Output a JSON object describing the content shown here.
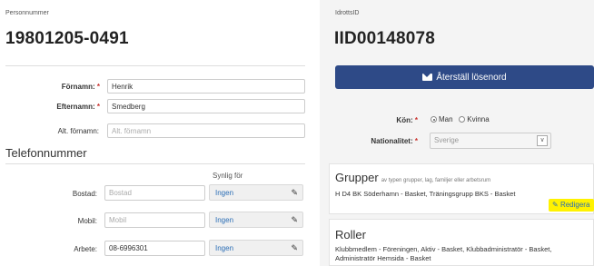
{
  "left": {
    "person_label": "Personnummer",
    "person_number": "19801205-0491",
    "fields": {
      "fornamn_label": "Förnamn:",
      "fornamn_value": "Henrik",
      "efternamn_label": "Efternamn:",
      "efternamn_value": "Smedberg",
      "alt_fornamn_label": "Alt. förnamn:",
      "alt_fornamn_placeholder": "Alt. förnamn",
      "required_mark": "*"
    },
    "phone": {
      "section_title": "Telefonnummer",
      "visible_for_header": "Synlig för",
      "rows": [
        {
          "label": "Bostad:",
          "value": "",
          "placeholder": "Bostad",
          "visibility": "Ingen"
        },
        {
          "label": "Mobil:",
          "value": "",
          "placeholder": "Mobil",
          "visibility": "Ingen"
        },
        {
          "label": "Arbete:",
          "value": "08-6996301",
          "placeholder": "",
          "visibility": "Ingen"
        }
      ]
    }
  },
  "right": {
    "idrotts_label": "IdrottsID",
    "idrotts_id": "IID00148078",
    "reset_button": "Återställ lösenord",
    "gender": {
      "label": "Kön:",
      "options": [
        "Man",
        "Kvinna"
      ],
      "selected": "Man"
    },
    "nationality": {
      "label": "Nationalitet:",
      "value": "Sverige"
    },
    "groups": {
      "title": "Grupper",
      "subtitle": "av typen grupper, lag, familjer eller arbetsrum",
      "text": "H D4 BK Söderhamn - Basket, Träningsgrupp BKS - Basket",
      "edit_button": "Redigera"
    },
    "roles": {
      "title": "Roller",
      "text_line1": "Klubbmedlem - Föreningen, Aktiv - Basket, Klubbadministratör - Basket,",
      "text_line2": "Administratör Hemsida - Basket"
    }
  },
  "colors": {
    "primary_button": "#2e4a87",
    "link": "#2a6db5",
    "required": "#c9302c",
    "highlight": "#fff200"
  }
}
